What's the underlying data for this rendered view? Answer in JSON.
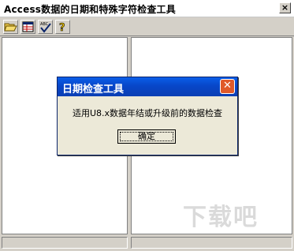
{
  "window": {
    "title": "Access数据的日期和特殊字符检查工具",
    "close_glyph": "×"
  },
  "toolbar": {
    "icons": [
      "open-folder-icon",
      "grid-icon",
      "spell-check-icon",
      "help-icon"
    ]
  },
  "dialog": {
    "title": "日期检查工具",
    "message": "适用U8.x数据年结或升级前的数据检查",
    "ok_label": "确定",
    "close_glyph": "✕"
  },
  "watermark": {
    "text": "下载吧"
  },
  "colors": {
    "dialog_title": "#0846c8",
    "dialog_close": "#e05a2a",
    "chrome": "#d4d0c8"
  }
}
